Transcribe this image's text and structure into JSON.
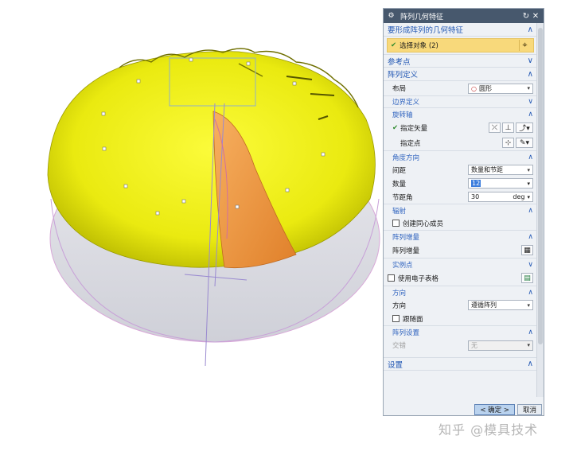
{
  "dialog": {
    "title": "阵列几何特征",
    "sections": {
      "feature": {
        "label": "要形成阵列的几何特征",
        "select_label": "选择对象 (2)"
      },
      "ref_point": {
        "label": "参考点"
      },
      "pattern_def": {
        "label": "阵列定义",
        "layout_label": "布局",
        "layout_value": "圆形",
        "boundary_label": "边界定义",
        "rot_axis_label": "旋转轴",
        "vector_label": "指定矢量",
        "point_label": "指定点",
        "angle_label": "角度方向",
        "spacing_label": "间距",
        "spacing_value": "数量和节距",
        "count_label": "数量",
        "count_value": "12",
        "pitch_label": "节距角",
        "pitch_value": "30",
        "pitch_unit": "deg",
        "radiate_label": "辐射",
        "concentric_label": "创建同心成员",
        "increment_label": "阵列增量",
        "increment_row_label": "阵列增量",
        "instance_label": "实例点",
        "spreadsheet_label": "使用电子表格",
        "orientation_label": "方向",
        "orientation_row_label": "方向",
        "orientation_value": "遵循阵列",
        "follow_face_label": "跟随面",
        "settings_label": "阵列设置",
        "interleave_label": "交错",
        "interleave_value": "无"
      },
      "settings": {
        "label": "设置"
      }
    },
    "ok_label": "< 确定 >",
    "cancel_label": "取消"
  },
  "watermark": "知乎 @模具技术"
}
